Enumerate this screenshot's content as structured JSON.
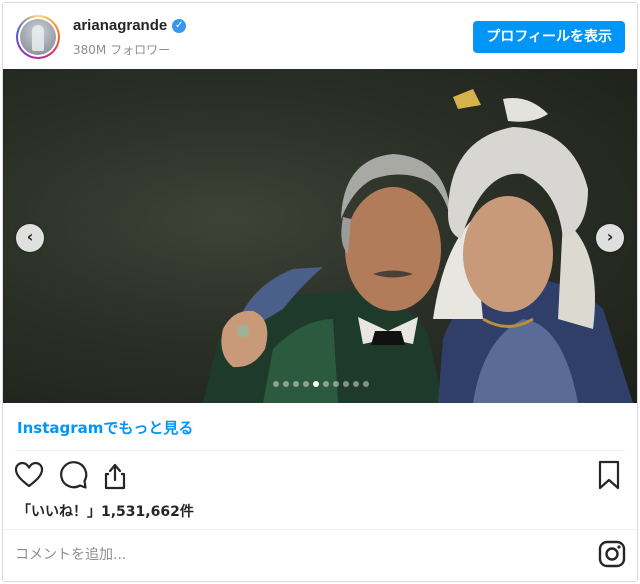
{
  "header": {
    "username": "arianagrande",
    "verified_glyph": "✓",
    "followers": "380M フォロワー",
    "profile_button": "プロフィールを表示"
  },
  "post": {
    "image_alt": "",
    "carousel": {
      "total_slides": 10,
      "active_index": 4
    },
    "nav_prev_glyph": "‹",
    "nav_next_glyph": "›"
  },
  "more_link": "Instagramでもっと見る",
  "actions": {
    "like_icon": "heart-icon",
    "comment_icon": "comment-icon",
    "share_icon": "share-icon",
    "save_icon": "bookmark-icon"
  },
  "likes": {
    "label": "「いいね！」",
    "count": "1,531,662件"
  },
  "comment": {
    "placeholder": "コメントを追加..."
  },
  "colors": {
    "accent": "#0095f6",
    "verified": "#3897f0",
    "text": "#262626",
    "muted": "#8e8e8e"
  }
}
